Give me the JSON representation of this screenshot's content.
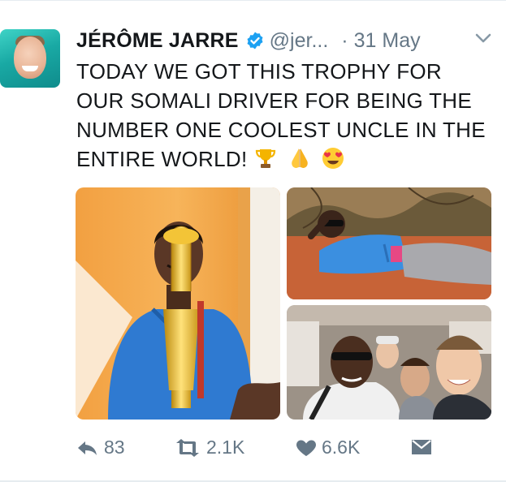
{
  "tweet": {
    "author_name": "JÉRÔME JARRE",
    "handle": "@jer...",
    "separator": "·",
    "date": "31 May",
    "text": "TODAY WE GOT THIS TROPHY FOR OUR SOMALI DRIVER FOR BEING THE NUMBER ONE COOLEST UNCLE IN THE ENTIRE WORLD!",
    "emojis": [
      "trophy-emoji",
      "folded-hands-emoji",
      "heart-eyes-emoji"
    ],
    "media": [
      "trophy-photo",
      "lying-in-desert-photo",
      "car-selfie-photo"
    ]
  },
  "actions": {
    "reply_count": "83",
    "retweet_count": "2.1K",
    "like_count": "6.6K"
  },
  "colors": {
    "text": "#14171a",
    "muted": "#657786",
    "verified": "#1da1f2"
  },
  "icons": [
    "verified-badge-icon",
    "chevron-down-icon",
    "reply-icon",
    "retweet-icon",
    "heart-icon",
    "direct-message-icon"
  ]
}
